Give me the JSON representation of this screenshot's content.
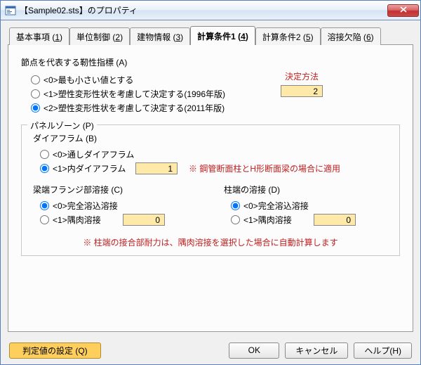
{
  "window": {
    "title": "【Sample02.sts】のプロパティ"
  },
  "tabs": [
    {
      "label": "基本事項",
      "accel": "1"
    },
    {
      "label": "単位制御",
      "accel": "2"
    },
    {
      "label": "建物情報",
      "accel": "3"
    },
    {
      "label": "計算条件1",
      "accel": "4"
    },
    {
      "label": "計算条件2",
      "accel": "5"
    },
    {
      "label": "溶接欠陥",
      "accel": "6"
    }
  ],
  "groupA": {
    "title": "節点を代表する靭性指標 (A)",
    "opts": [
      "<0>最も小さい値とする",
      "<1>塑性変形性状を考慮して決定する(1996年版)",
      "<2>塑性変形性状を考慮して決定する(2011年版)"
    ],
    "decision_label": "決定方法",
    "decision_value": "2"
  },
  "panelZone": {
    "title": "パネルゾーン (P)",
    "diaphragm": {
      "title": "ダイアフラム (B)",
      "opts": [
        "<0>通しダイアフラム",
        "<1>内ダイアフラム"
      ],
      "value": "1",
      "note": "※ 鋼管断面柱とH形断面梁の場合に適用"
    },
    "beamWeld": {
      "title": "梁端フランジ部溶接 (C)",
      "opts": [
        "<0>完全溶込溶接",
        "<1>隅肉溶接"
      ],
      "value": "0"
    },
    "colWeld": {
      "title": "柱端の溶接 (D)",
      "opts": [
        "<0>完全溶込溶接",
        "<1>隅肉溶接"
      ],
      "value": "0"
    },
    "footnote": "※ 柱端の接合部耐力は、隅肉溶接を選択した場合に自動計算します"
  },
  "buttons": {
    "settings": "判定値の設定 (Q)",
    "ok": "OK",
    "cancel": "キャンセル",
    "help": "ヘルプ(H)"
  }
}
